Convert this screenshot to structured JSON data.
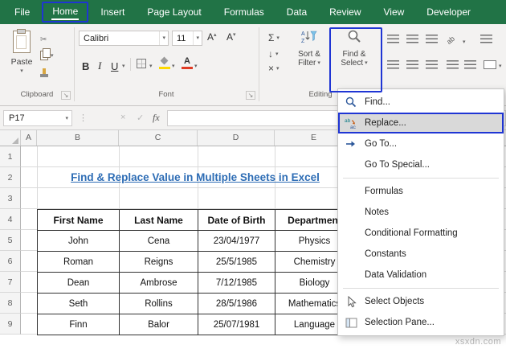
{
  "colors": {
    "excel_green": "#217346",
    "annotation_blue": "#1f35d4",
    "title_blue": "#2e6db5",
    "menu_accent": "#2b579a",
    "fill_yellow": "#ffd900",
    "font_color_red": "#e03b24"
  },
  "tabbar": {
    "tabs": [
      {
        "label": "File",
        "active": false
      },
      {
        "label": "Home",
        "active": true
      },
      {
        "label": "Insert",
        "active": false
      },
      {
        "label": "Page Layout",
        "active": false
      },
      {
        "label": "Formulas",
        "active": false
      },
      {
        "label": "Data",
        "active": false
      },
      {
        "label": "Review",
        "active": false
      },
      {
        "label": "View",
        "active": false
      },
      {
        "label": "Developer",
        "active": false
      }
    ]
  },
  "ribbon": {
    "groups": {
      "clipboard": "Clipboard",
      "font": "Font",
      "editing": "Editing"
    },
    "paste_label": "Paste",
    "font_name": "Calibri",
    "font_size": "11",
    "bold_label": "B",
    "italic_label": "I",
    "underline_label": "U",
    "grow_font_label": "A",
    "shrink_font_label": "A",
    "font_color_label": "A",
    "autosum_symbol": "Σ",
    "fill_symbol": "↓",
    "clear_symbol": "×",
    "sort_filter_line1": "Sort &",
    "sort_filter_line2": "Filter",
    "find_select_line1": "Find &",
    "find_select_line2": "Select"
  },
  "formula_bar": {
    "name_box_value": "P17",
    "cancel_symbol": "×",
    "enter_symbol": "✓",
    "fx_label": "fx",
    "formula_value": ""
  },
  "menu": {
    "items": [
      {
        "label": "Find...",
        "icon": "magnifier-icon",
        "highlighted": false
      },
      {
        "label": "Replace...",
        "icon": "replace-icon",
        "highlighted": true
      },
      {
        "label": "Go To...",
        "icon": "arrow-right-icon",
        "highlighted": false
      },
      {
        "label": "Go To Special...",
        "icon": "",
        "highlighted": false
      },
      {
        "label": "Formulas",
        "icon": "",
        "highlighted": false
      },
      {
        "label": "Notes",
        "icon": "",
        "highlighted": false
      },
      {
        "label": "Conditional Formatting",
        "icon": "",
        "highlighted": false
      },
      {
        "label": "Constants",
        "icon": "",
        "highlighted": false
      },
      {
        "label": "Data Validation",
        "icon": "",
        "highlighted": false
      },
      {
        "label": "Select Objects",
        "icon": "cursor-icon",
        "highlighted": false
      },
      {
        "label": "Selection Pane...",
        "icon": "pane-icon",
        "highlighted": false
      }
    ]
  },
  "sheet": {
    "column_headers": [
      "A",
      "B",
      "C",
      "D",
      "E"
    ],
    "row_headers": [
      "1",
      "2",
      "3",
      "4",
      "5",
      "6",
      "7",
      "8",
      "9"
    ],
    "title": "Find & Replace Value in Multiple Sheets in Excel",
    "table": {
      "headers": [
        "First Name",
        "Last Name",
        "Date of Birth",
        "Department"
      ],
      "rows": [
        [
          "John",
          "Cena",
          "23/04/1977",
          "Physics"
        ],
        [
          "Roman",
          "Reigns",
          "25/5/1985",
          "Chemistry"
        ],
        [
          "Dean",
          "Ambrose",
          "7/12/1985",
          "Biology"
        ],
        [
          "Seth",
          "Rollins",
          "28/5/1986",
          "Mathematics"
        ],
        [
          "Finn",
          "Balor",
          "25/07/1981",
          "Language"
        ]
      ]
    }
  },
  "watermark": "xsxdn.com"
}
